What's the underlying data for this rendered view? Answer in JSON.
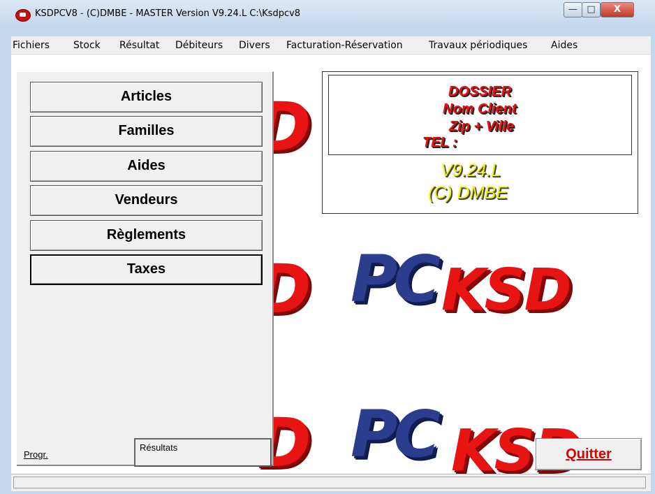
{
  "window": {
    "title": "KSDPCV8 - (C)DMBE - MASTER Version V9.24.L C:\\Ksdpcv8",
    "minimize_glyph": "—",
    "maximize_glyph": "□",
    "close_glyph": "X"
  },
  "menu": [
    "Fichiers",
    "Stock",
    "Résultat",
    "Débiteurs",
    "Divers",
    "Facturation-Réservation",
    "Travaux périodiques",
    "Aides"
  ],
  "panel": {
    "buttons": [
      "Articles",
      "Familles",
      "Aides",
      "Vendeurs",
      "Règlements",
      "Taxes"
    ],
    "active_button": "Taxes",
    "progr_label": "Progr.",
    "results_button_label": "Résultats"
  },
  "info": {
    "dossier": "DOSSIER",
    "nom_client": "Nom Client",
    "zip_ville": "Zip + Ville",
    "tel": "TEL :",
    "version": "V9.24.L",
    "copyright": "(C) DMBE"
  },
  "quit_label": "Quitter",
  "logo_text": {
    "d": "D",
    "pc": "PC",
    "ksd": "KSD"
  },
  "colors": {
    "logo_red": "#e81414",
    "logo_blue": "#2b3d8c",
    "version_yellow": "#f3ef18",
    "quit_red": "#dd0000"
  }
}
